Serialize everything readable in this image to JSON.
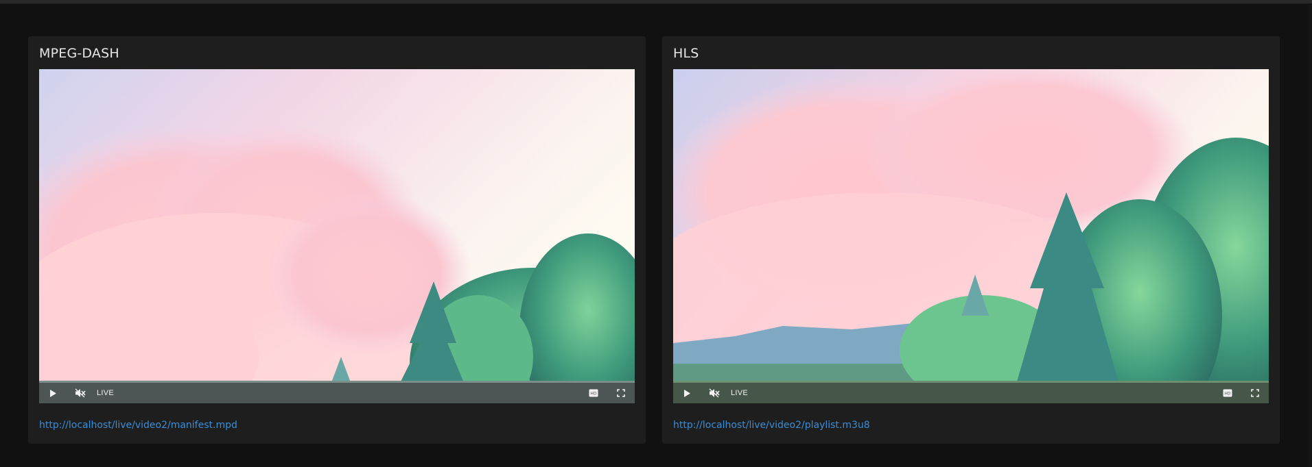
{
  "players": [
    {
      "title": "MPEG-DASH",
      "live_label": "LIVE",
      "url": "http://localhost/live/video2/manifest.mpd"
    },
    {
      "title": "HLS",
      "live_label": "LIVE",
      "url": "http://localhost/live/video2/playlist.m3u8"
    }
  ],
  "icons": {
    "play": "play-icon",
    "mute": "volume-muted-icon",
    "hd": "hd-icon",
    "fullscreen": "fullscreen-icon"
  },
  "colors": {
    "page_bg": "#111111",
    "card_bg": "#1e1e1e",
    "title": "#e6e6e6",
    "link": "#3b8ed8"
  }
}
